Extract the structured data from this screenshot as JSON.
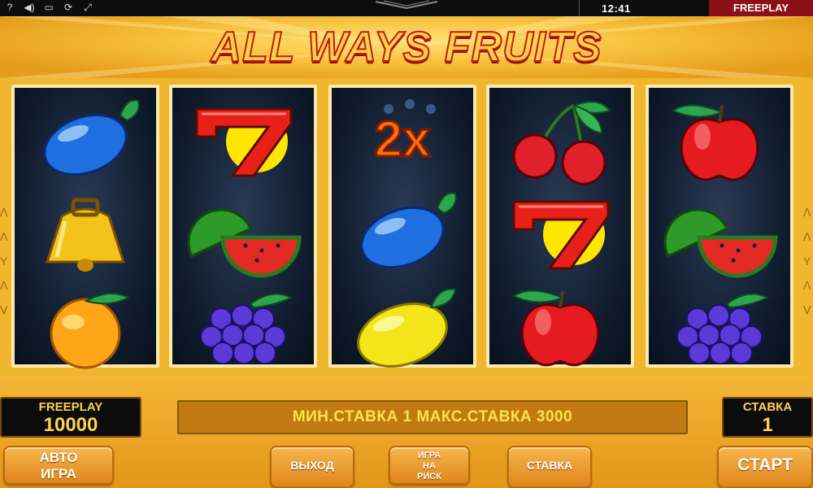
{
  "status_bar": {
    "time": "12:41",
    "mode": "FREEPLAY",
    "icons": [
      "help-icon",
      "sound-icon",
      "window-icon",
      "refresh-icon",
      "fullscreen-icon"
    ],
    "icon_glyphs": [
      "?",
      "◀)",
      "▭",
      "⟳",
      "⤢"
    ]
  },
  "game": {
    "title": "ALL WAYS FRUITS"
  },
  "reels": [
    [
      "plum",
      "bell",
      "orange"
    ],
    [
      "seven",
      "watermelon",
      "grapes"
    ],
    [
      "2x",
      "plum",
      "lemon"
    ],
    [
      "cherries",
      "seven",
      "apple"
    ],
    [
      "apple",
      "watermelon",
      "grapes"
    ]
  ],
  "panel": {
    "credits_label": "FREEPLAY",
    "credits_value": "10000",
    "info_text": "МИН.СТАВКА 1 МАКС.СТАВКА 3000",
    "bet_label": "СТАВКА",
    "bet_value": "1",
    "buttons": {
      "auto_line1": "АВТО",
      "auto_line2": "ИГРА",
      "exit": "ВЫХОД",
      "gamble_line1": "ИГРА",
      "gamble_line2": "НА",
      "gamble_line3": "РИСК",
      "bet": "СТАВКА",
      "start": "СТАРТ"
    }
  },
  "colors": {
    "accent": "#f0b62d",
    "title_fill": "#ffd24a",
    "title_stroke": "#c31a10",
    "reel_bg": "#0e1a2b",
    "status_red": "#8a0f17"
  }
}
